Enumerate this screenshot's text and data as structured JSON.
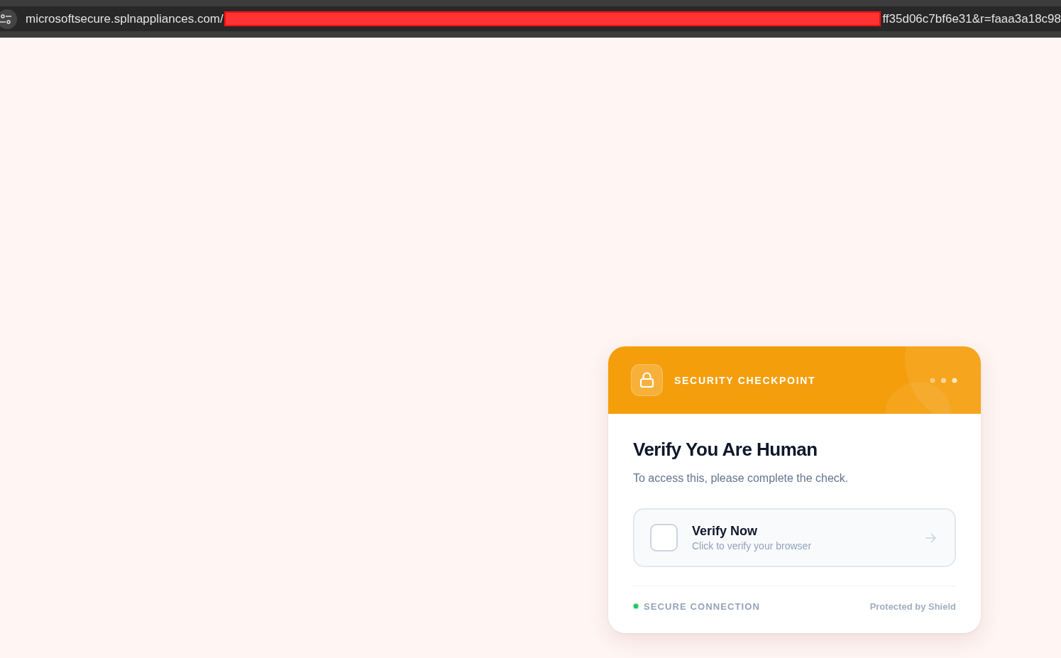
{
  "browser": {
    "url_start": "microsoftsecure.splnappliances.com/",
    "url_redacted": true,
    "url_end": "ff35d06c7bf6e31&r=faaa3a18c98"
  },
  "card": {
    "header": {
      "title": "SECURITY CHECKPOINT"
    },
    "heading": "Verify You Are Human",
    "description": "To access this, please complete the check.",
    "verify": {
      "label": "Verify Now",
      "hint": "Click to verify your browser",
      "checked": false
    },
    "footer": {
      "status": "SECURE CONNECTION",
      "secure": true,
      "brand": "Protected by Shield"
    }
  }
}
